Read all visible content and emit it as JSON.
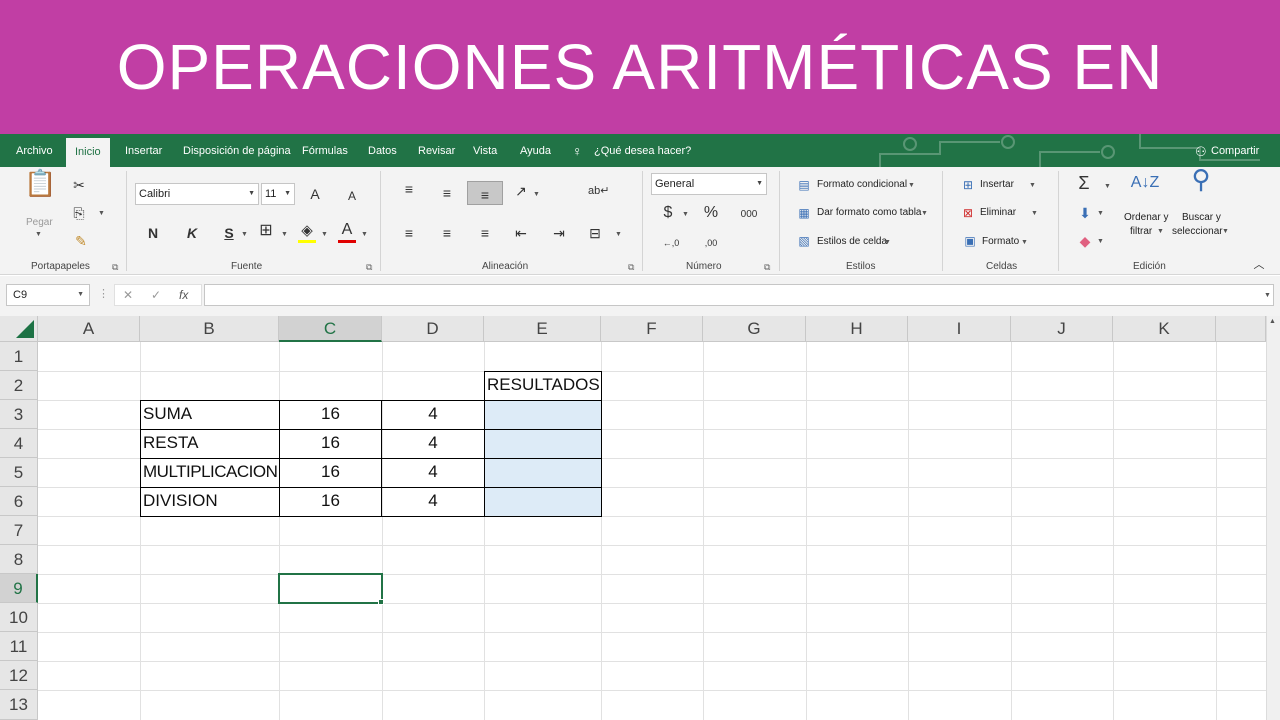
{
  "banner": {
    "title": "OPERACIONES ARITMÉTICAS EN EXCEL"
  },
  "tabs": {
    "file": "Archivo",
    "home": "Inicio",
    "insert": "Insertar",
    "layout": "Disposición de página",
    "formulas": "Fórmulas",
    "data": "Datos",
    "review": "Revisar",
    "view": "Vista",
    "help": "Ayuda",
    "tellme": "¿Qué desea hacer?",
    "share": "Compartir"
  },
  "ribbon": {
    "clipboard": {
      "label": "Portapapeles",
      "paste": "Pegar"
    },
    "font": {
      "label": "Fuente",
      "name": "Calibri",
      "size": "11",
      "bold": "N",
      "italic": "K",
      "underline": "S",
      "grow": "A",
      "shrink": "A"
    },
    "alignment": {
      "label": "Alineación"
    },
    "number": {
      "label": "Número",
      "format": "General",
      "currency": "$",
      "percent": "%",
      "thousands": "000",
      "inc_decimal": "←,0",
      "dec_decimal": ",00"
    },
    "styles": {
      "label": "Estilos",
      "conditional": "Formato condicional",
      "as_table": "Dar formato como tabla",
      "cell_styles": "Estilos de celda"
    },
    "cells": {
      "label": "Celdas",
      "insert": "Insertar",
      "delete": "Eliminar",
      "format": "Formato"
    },
    "editing": {
      "label": "Edición",
      "sum": "Σ",
      "sort": "Ordenar y",
      "sort2": "filtrar",
      "find": "Buscar y",
      "find2": "seleccionar"
    }
  },
  "formula_bar": {
    "name_box": "C9",
    "cancel": "✕",
    "enter": "✓",
    "fx": "fx",
    "formula": ""
  },
  "grid": {
    "columns": [
      "A",
      "B",
      "C",
      "D",
      "E",
      "F",
      "G",
      "H",
      "I",
      "J",
      "K"
    ],
    "rows": [
      "1",
      "2",
      "3",
      "4",
      "5",
      "6",
      "7",
      "8",
      "9",
      "10",
      "11",
      "12",
      "13"
    ],
    "header_e2": "RESULTADOS",
    "data": [
      {
        "op": "SUMA",
        "a": "16",
        "b": "4"
      },
      {
        "op": "RESTA",
        "a": "16",
        "b": "4"
      },
      {
        "op": "MULTIPLICACION",
        "a": "16",
        "b": "4"
      },
      {
        "op": "DIVISION",
        "a": "16",
        "b": "4"
      }
    ]
  },
  "colors": {
    "banner": "#c13ea4",
    "excel_green": "#217346",
    "result_fill": "#ddebf7"
  }
}
